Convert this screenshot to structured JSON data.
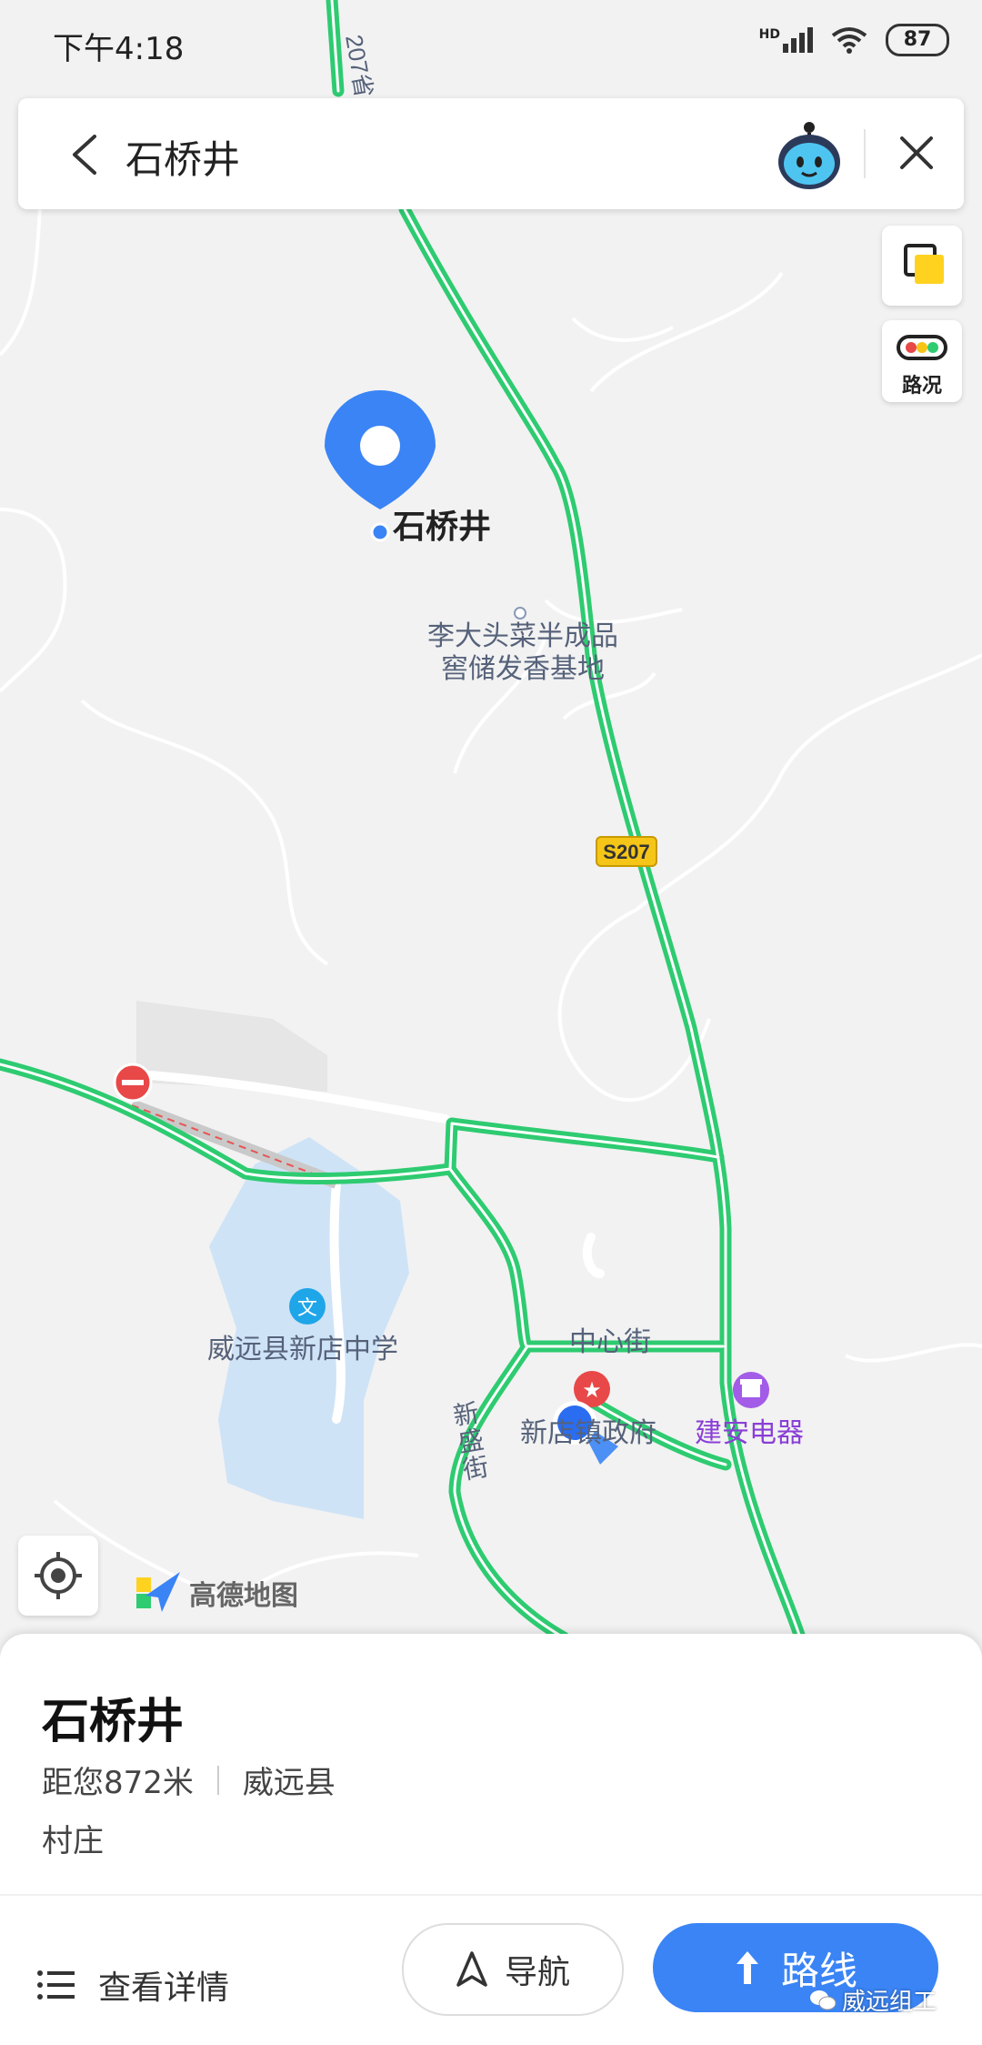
{
  "status_bar": {
    "time": "下午4:18",
    "hd": "HD",
    "battery": "87"
  },
  "search": {
    "query": "石桥井"
  },
  "map": {
    "traffic_label": "路况",
    "selected_marker_label": "石桥井",
    "road_badge": "S207",
    "road_vertical_label": "207省",
    "poi": {
      "lidatou_line1": "李大头菜半成品",
      "lidatou_line2": "窖储发香基地",
      "school": "威远县新店中学",
      "street_center": "中心街",
      "street_xinsheng": "新盛街",
      "gov": "新店镇政府",
      "appliance": "建安电器"
    },
    "logo_text": "高德地图",
    "colors": {
      "road": "#2ecb71",
      "water": "#cfe3f7",
      "accent": "#3a84f5"
    }
  },
  "panel": {
    "title": "石桥井",
    "distance": "距您872米",
    "county": "威远县",
    "type": "村庄",
    "details_label": "查看详情",
    "nav_label": "导航",
    "route_label": "路线",
    "watermark": "威远组工"
  }
}
